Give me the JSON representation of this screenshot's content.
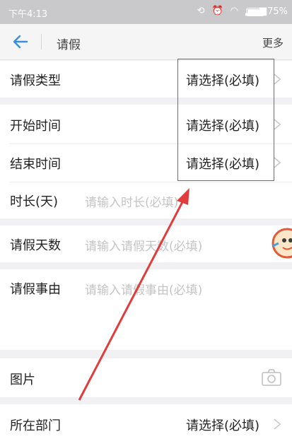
{
  "status_bar": {
    "time": "下午4:13",
    "battery": "75%"
  },
  "header": {
    "title": "请假",
    "more_label": "更多"
  },
  "form": {
    "leave_type": {
      "label": "请假类型",
      "value": "请选择(必填)"
    },
    "start_time": {
      "label": "开始时间",
      "value": "请选择(必填)"
    },
    "end_time": {
      "label": "结束时间",
      "value": "请选择(必填)"
    },
    "duration": {
      "label": "时长(天)",
      "placeholder": "请输入时长(必填)"
    },
    "leave_days": {
      "label": "请假天数",
      "placeholder": "请输入请假天数(必填)"
    },
    "reason": {
      "label": "请假事由",
      "placeholder": "请输入请假事由(必填)"
    },
    "picture": {
      "label": "图片"
    },
    "department": {
      "label": "所在部门",
      "value": "请选择(必填)"
    }
  },
  "colors": {
    "accent": "#3c8fd8",
    "annotation": "#e03c3c"
  }
}
